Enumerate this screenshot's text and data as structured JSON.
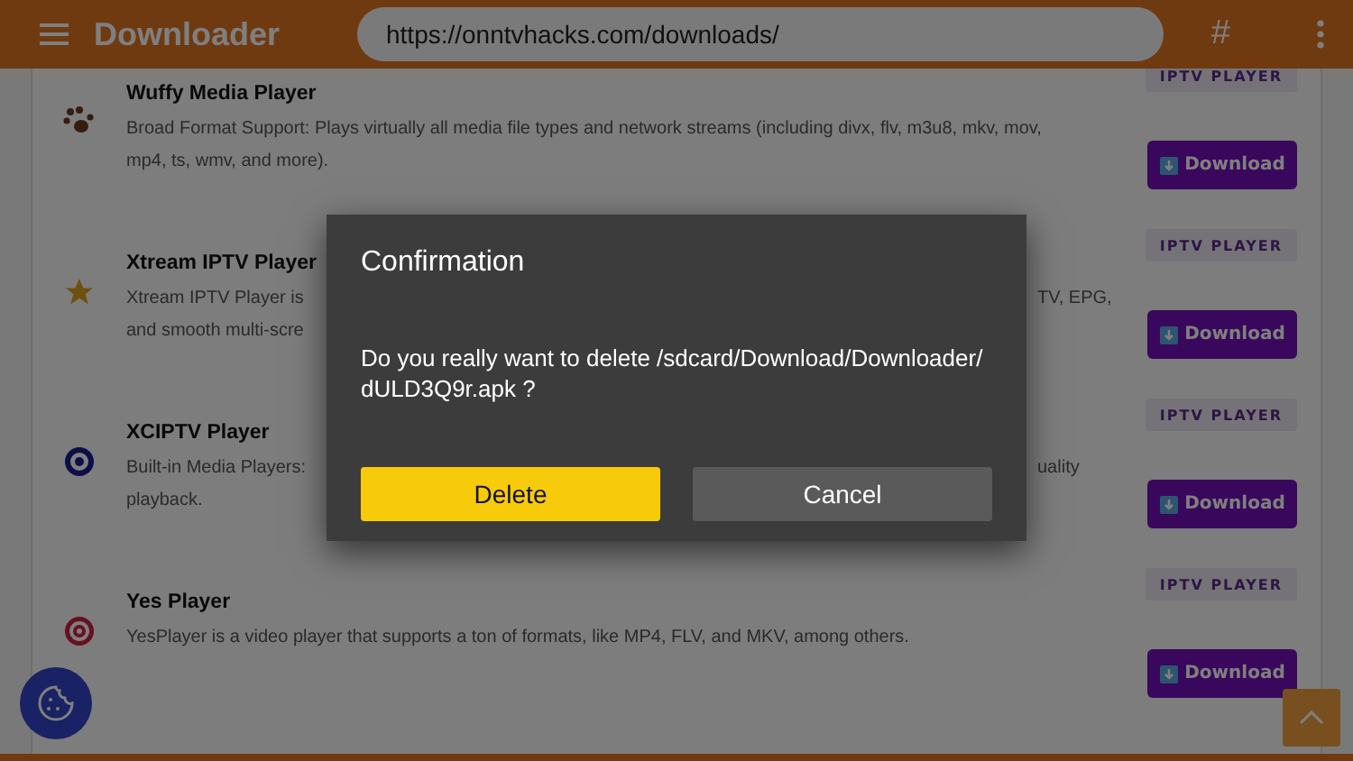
{
  "header": {
    "logo": "Downloader",
    "url": "https://onntvhacks.com/downloads/",
    "hash_button": "#"
  },
  "apps": [
    {
      "kind": "paw",
      "title": "Wuffy Media Player",
      "badge": "IPTV PLAYER",
      "description_lines": [
        {
          "left": "Broad Format Support: Plays virtually all media file types and network streams (including divx, flv, m3u8, mkv, mov,"
        },
        {
          "left": "mp4, ts, wmv, and more)."
        }
      ],
      "button": "Download"
    },
    {
      "kind": "star",
      "title": "Xtream IPTV Player",
      "badge": "IPTV PLAYER",
      "description_lines": [
        {
          "left": "Xtream IPTV Player is",
          "right": "TV, EPG,"
        },
        {
          "left": "and smooth multi-scre"
        }
      ],
      "button": "Download"
    },
    {
      "kind": "eye",
      "title": "XCIPTV Player",
      "badge": "IPTV PLAYER",
      "description_lines": [
        {
          "left": "Built-in Media Players:",
          "right": "uality"
        },
        {
          "left": "playback."
        }
      ],
      "button": "Download"
    },
    {
      "kind": "target",
      "title": "Yes Player",
      "badge": "IPTV PLAYER",
      "description_lines": [
        {
          "left": "YesPlayer is a video player that supports a ton of formats, like MP4, FLV, and MKV, among others."
        }
      ],
      "button": "Download"
    }
  ],
  "dialog": {
    "title": "Confirmation",
    "message": "Do you really want to delete /sdcard/Download/Downloader/ dULD3Q9r.apk ?",
    "buttons": [
      {
        "label": "Delete",
        "kind": "primary"
      },
      {
        "label": "Cancel",
        "kind": "secondary"
      }
    ]
  }
}
